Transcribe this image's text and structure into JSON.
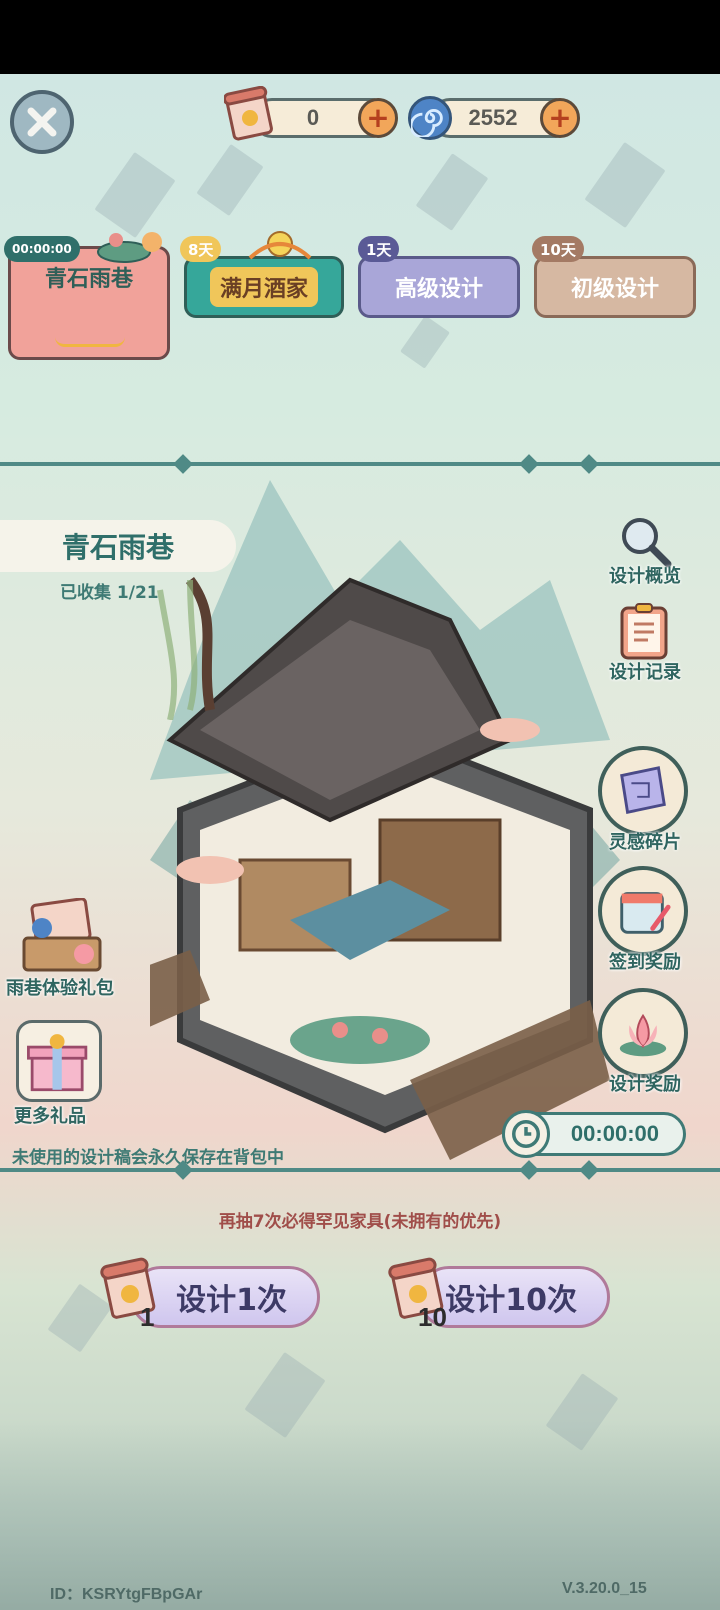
{
  "header": {
    "scroll_count": "0",
    "coin_count": "2552"
  },
  "tabs": [
    {
      "label": "青石雨巷",
      "badge": "00:00:00"
    },
    {
      "label": "满月酒家",
      "badge": "8天"
    },
    {
      "label": "高级设计",
      "badge": "1天"
    },
    {
      "label": "初级设计",
      "badge": "10天"
    }
  ],
  "scene": {
    "title": "青石雨巷",
    "collected": "已收集 1/21",
    "notice": "未使用的设计稿会永久保存在背包中",
    "timer": "00:00:00"
  },
  "side_menu": {
    "overview": "设计概览",
    "records": "设计记录",
    "inspiration": "灵感碎片",
    "checkin": "签到奖励",
    "design_reward": "设计奖励"
  },
  "left_menu": {
    "gift_pack": "雨巷体验礼包",
    "more_gifts": "更多礼品"
  },
  "draw": {
    "hint": "再抽7次必得罕见家具(未拥有的优先)",
    "single_label": "设计1次",
    "single_count": "1",
    "ten_label": "设计10次",
    "ten_count": "10"
  },
  "footer": {
    "id": "ID：KSRYtgFBpGAr",
    "version": "V.3.20.0_15"
  },
  "colors": {
    "accent_teal": "#4f8a86",
    "tab_active": "#f1a29a",
    "tab_gold": "#f0c65a",
    "tab_purple": "#a9a6d8",
    "tab_tan": "#d6b8a2"
  }
}
